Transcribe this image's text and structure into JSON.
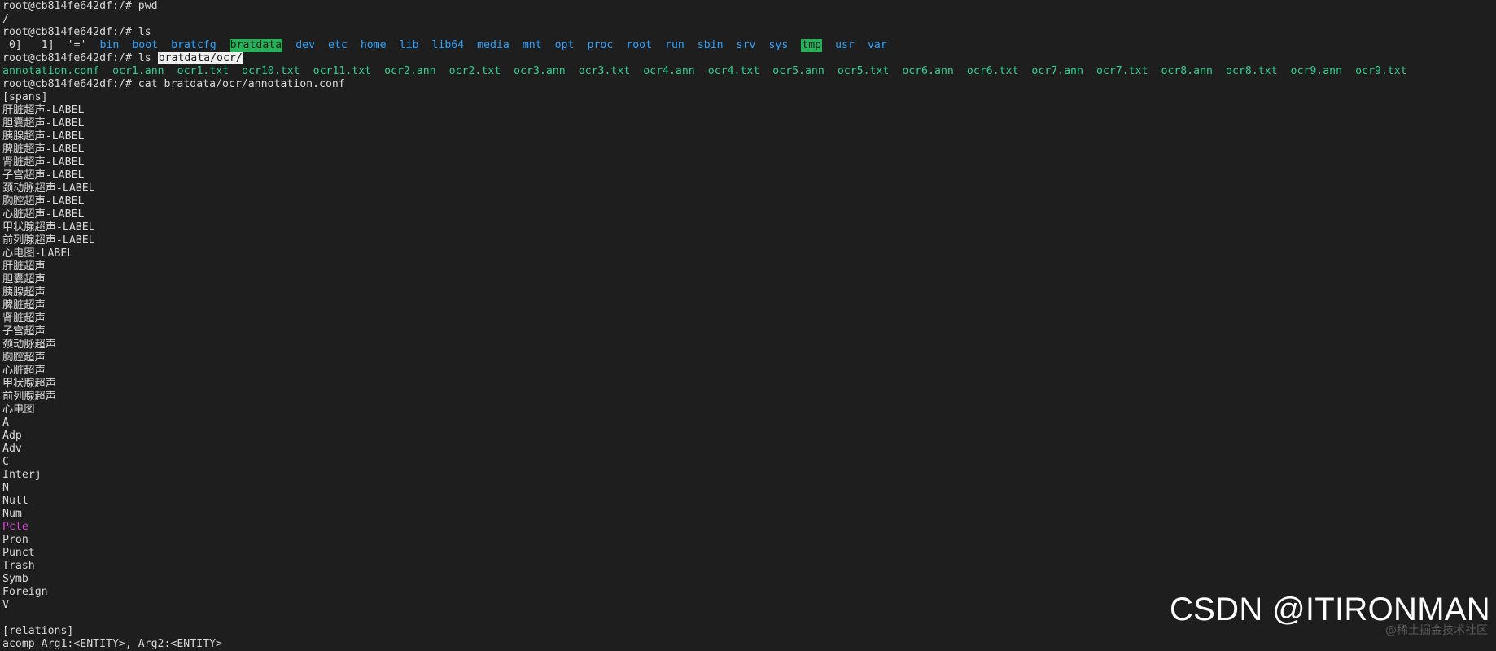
{
  "prompt": "root@cb814fe642df:/#",
  "cmd_pwd": "pwd",
  "out_pwd": "/",
  "cmd_ls": "ls",
  "ls_root": {
    "plain1": " 0]",
    "plain2": " 1]",
    "plain3": "'='",
    "dirs_before": [
      "bin",
      "boot",
      "bratcfg"
    ],
    "highlight_dir": "bratdata",
    "dirs_middle": [
      "dev",
      "etc",
      "home",
      "lib",
      "lib64",
      "media",
      "mnt",
      "opt",
      "proc",
      "root",
      "run",
      "sbin",
      "srv",
      "sys"
    ],
    "highlight_dir2": "tmp",
    "dirs_after": [
      "usr",
      "var"
    ]
  },
  "cmd_ls_ocr_prefix": "ls",
  "cmd_ls_ocr_arg": "bratdata/ocr/",
  "ls_ocr_files": [
    "annotation.conf",
    "ocr1.ann",
    "ocr1.txt",
    "ocr10.txt",
    "ocr11.txt",
    "ocr2.ann",
    "ocr2.txt",
    "ocr3.ann",
    "ocr3.txt",
    "ocr4.ann",
    "ocr4.txt",
    "ocr5.ann",
    "ocr5.txt",
    "ocr6.ann",
    "ocr6.txt",
    "ocr7.ann",
    "ocr7.txt",
    "ocr8.ann",
    "ocr8.txt",
    "ocr9.ann",
    "ocr9.txt"
  ],
  "cmd_cat": "cat bratdata/ocr/annotation.conf",
  "spans_header": "[spans]",
  "spans_before_pcle": [
    "肝脏超声-LABEL",
    "胆囊超声-LABEL",
    "胰腺超声-LABEL",
    "脾脏超声-LABEL",
    "肾脏超声-LABEL",
    "子宫超声-LABEL",
    "颈动脉超声-LABEL",
    "胸腔超声-LABEL",
    "心脏超声-LABEL",
    "甲状腺超声-LABEL",
    "前列腺超声-LABEL",
    "心电图-LABEL",
    "肝脏超声",
    "胆囊超声",
    "胰腺超声",
    "脾脏超声",
    "肾脏超声",
    "子宫超声",
    "颈动脉超声",
    "胸腔超声",
    "心脏超声",
    "甲状腺超声",
    "前列腺超声",
    "心电图",
    "A",
    "Adp",
    "Adv",
    "C",
    "Interj",
    "N",
    "Null",
    "Num"
  ],
  "span_pcle": "Pcle",
  "spans_after_pcle": [
    "Pron",
    "Punct",
    "Trash",
    "Symb",
    "Foreign",
    "V"
  ],
  "relations_header": "[relations]",
  "relations_line": "acomp Arg1:<ENTITY>, Arg2:<ENTITY>",
  "watermark": "CSDN @ITIRONMAN",
  "watermark_sub": "@稀土掘金技术社区",
  "colors": {
    "background": "#1e1e1e",
    "text": "#d9d9d9",
    "dir": "#2aa3ff",
    "file": "#2fd08f",
    "highlight_dir_bg": "#25b35a",
    "magenta": "#d147d1"
  }
}
